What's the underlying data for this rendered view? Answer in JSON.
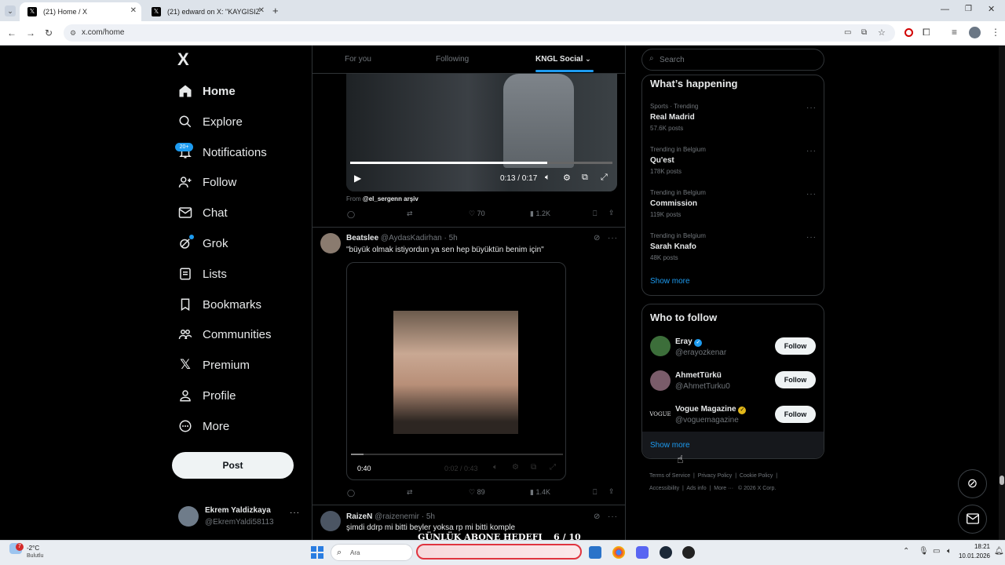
{
  "browser": {
    "tabs": [
      {
        "label": "(21) Home / X",
        "active": true
      },
      {
        "label": "(21) edward on X: \"KAYGISIZLA…",
        "active": false
      }
    ],
    "new_tab_icon": "plus-icon",
    "url": "x.com/home"
  },
  "nav": {
    "logo": "X",
    "items": [
      {
        "label": "Home",
        "icon": "home-icon"
      },
      {
        "label": "Explore",
        "icon": "search-icon"
      },
      {
        "label": "Notifications",
        "icon": "bell-icon",
        "badge": "20+"
      },
      {
        "label": "Follow",
        "icon": "person-plus-icon"
      },
      {
        "label": "Chat",
        "icon": "mail-icon"
      },
      {
        "label": "Grok",
        "icon": "grok-icon"
      },
      {
        "label": "Lists",
        "icon": "list-icon"
      },
      {
        "label": "Bookmarks",
        "icon": "bookmark-icon"
      },
      {
        "label": "Communities",
        "icon": "communities-icon"
      },
      {
        "label": "Premium",
        "icon": "x-icon"
      },
      {
        "label": "Profile",
        "icon": "person-icon"
      },
      {
        "label": "More",
        "icon": "more-circle-icon"
      }
    ],
    "post_label": "Post",
    "account": {
      "name": "Ekrem Yaldizkaya",
      "handle": "@EkremYaldi58113"
    }
  },
  "timeline": {
    "tabs": [
      "For you",
      "Following",
      "KNGL Social"
    ],
    "active_tab": "KNGL Social",
    "tweet1": {
      "video_time": "0:13 / 0:17",
      "video_progress": 0.75,
      "from_prefix": "From",
      "from_handle": "@el_sergenn arşiv",
      "likes": "70",
      "views": "1.2K"
    },
    "tweet2": {
      "name": "Beatslee",
      "handle": "@AydasKadirhan",
      "time": "· 5h",
      "text": "\"büyük olmak istiyordun ya sen hep büyüktün benim için\"",
      "video_elapsed": "0:40",
      "video_time": "0:02 / 0:43",
      "likes": "89",
      "views": "1.4K"
    },
    "tweet3": {
      "name": "RaizeN",
      "handle": "@raizenemir",
      "time": "· 5h",
      "text": "şimdi ddrp mi bitti beyler yoksa rp  mi bitti komple",
      "overlay": "GÜNLÜK ABONE HEDEFI",
      "overlay_count": "6  / 10"
    }
  },
  "sidebar": {
    "search_placeholder": "Search",
    "whats_happening": "What’s happening",
    "trends": [
      {
        "meta": "Sports · Trending",
        "name": "Real Madrid",
        "posts": "57.6K posts"
      },
      {
        "meta": "Trending in Belgium",
        "name": "Qu'est",
        "posts": "178K posts"
      },
      {
        "meta": "Trending in Belgium",
        "name": "Commission",
        "posts": "119K posts"
      },
      {
        "meta": "Trending in Belgium",
        "name": "Sarah Knafo",
        "posts": "48K posts"
      }
    ],
    "show_more": "Show more",
    "who_to_follow": "Who to follow",
    "follow_label": "Follow",
    "suggestions": [
      {
        "name": "Eray",
        "handle": "@erayozkenar",
        "verified": "blue"
      },
      {
        "name": "AhmetTürkü",
        "handle": "@AhmetTurku0",
        "verified": "none"
      },
      {
        "name": "Vogue Magazine",
        "handle": "@voguemagazine",
        "verified": "gold",
        "avatar_text": "VOGUE"
      }
    ],
    "show_more_2": "Show more",
    "footer": [
      "Terms of Service",
      "Privacy Policy",
      "Cookie Policy",
      "Accessibility",
      "Ads info",
      "More ···",
      "© 2026 X Corp."
    ]
  },
  "taskbar": {
    "weather_temp": "-2°C",
    "weather_desc": "Bulutlu",
    "weather_badge": "7",
    "search_label": "Ara",
    "time": "18:21",
    "date": "10.01.2026"
  },
  "colors": {
    "accent": "#1d9bf0",
    "bg": "#000000",
    "border": "#2f3336",
    "muted": "#71767b"
  }
}
